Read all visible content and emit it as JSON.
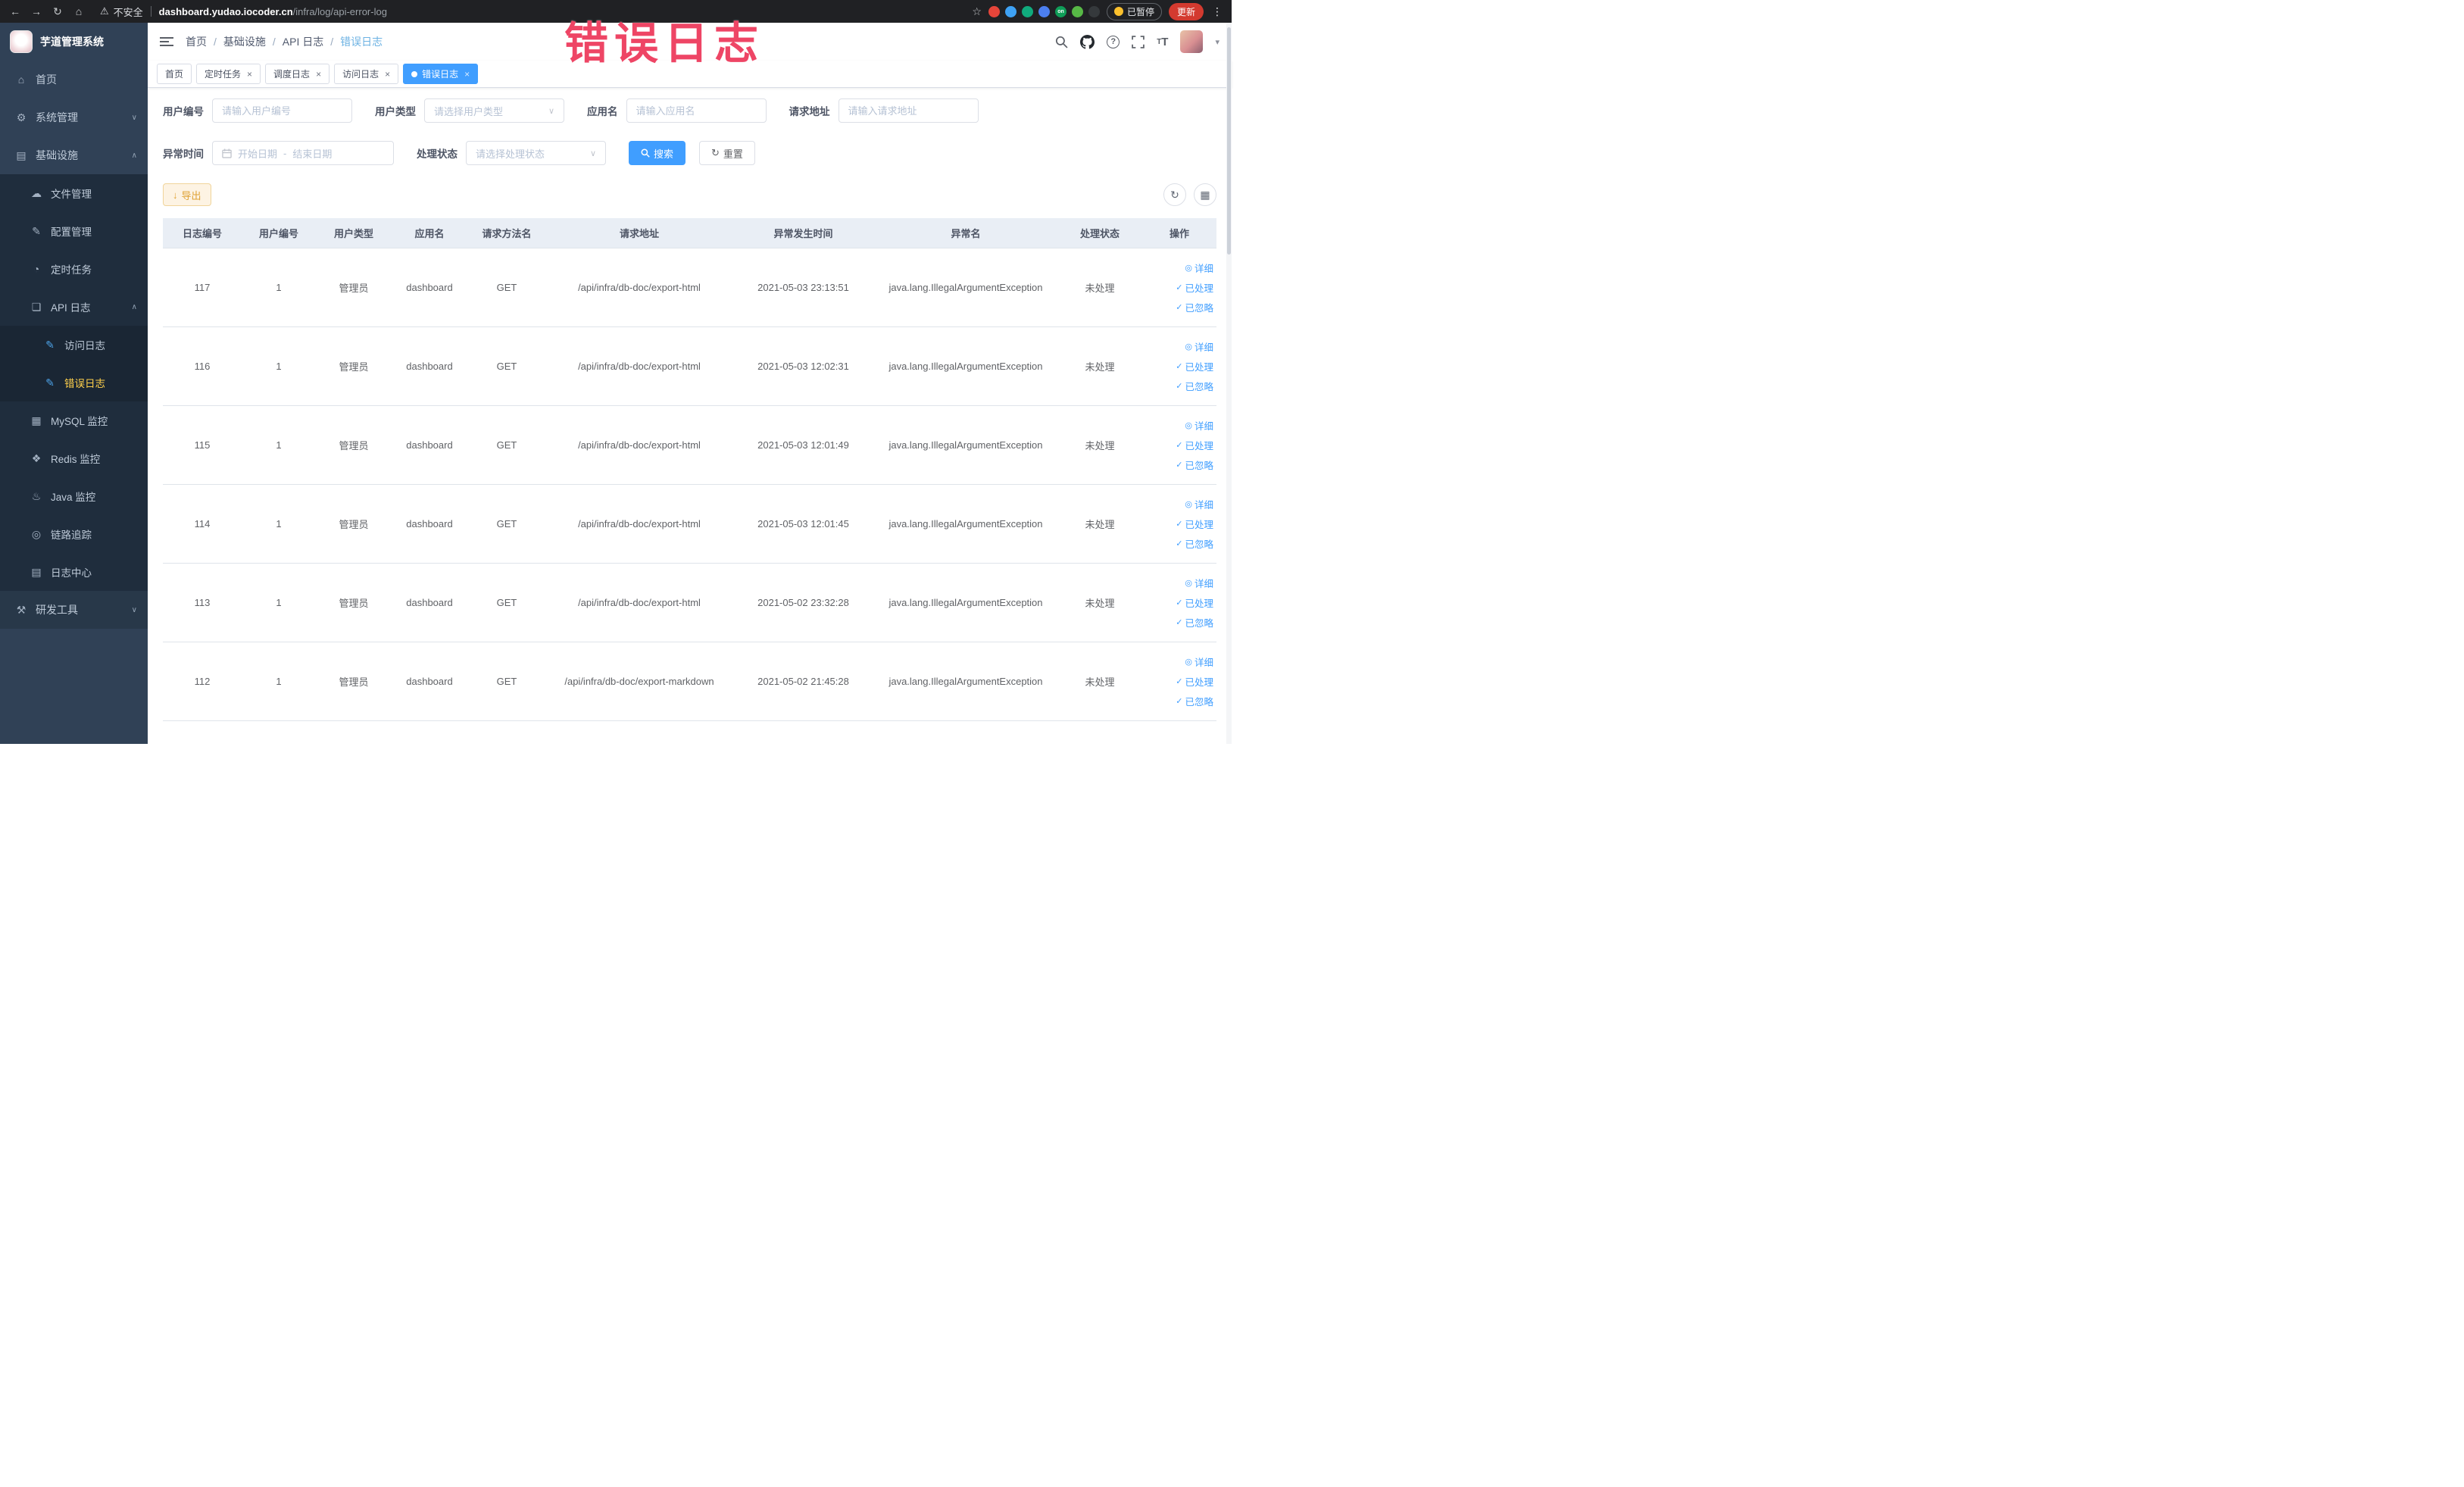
{
  "colors": {
    "accent": "#409eff",
    "menu_active": "#ffd04b",
    "warning": "#e6a23c"
  },
  "browser": {
    "security_label": "不安全",
    "url_domain": "dashboard.yudao.iocoder.cn",
    "url_path": "/infra/log/api-error-log",
    "paused_label": "已暂停",
    "update_label": "更新",
    "extensions": [
      {
        "name": "extension-red",
        "color": "#e5453a"
      },
      {
        "name": "extension-water",
        "color": "#3ea2f5"
      },
      {
        "name": "extension-teal",
        "color": "#10ab7d"
      },
      {
        "name": "extension-grid",
        "color": "#4c7ff0"
      },
      {
        "name": "extension-on",
        "color": "#0f9d58",
        "text": "on"
      },
      {
        "name": "extension-leaf",
        "color": "#57b846"
      },
      {
        "name": "extension-paw",
        "color": "#35393c"
      }
    ]
  },
  "annotation": {
    "text": "错误日志",
    "color": "#ee4565"
  },
  "sidebar": {
    "logo_title": "芋道管理系统",
    "items": [
      {
        "id": "home",
        "label": "首页",
        "icon": "home-icon",
        "glyph": "⌂",
        "level": 1
      },
      {
        "id": "system-management",
        "label": "系统管理",
        "icon": "gear-icon",
        "glyph": "⚙",
        "level": 1,
        "arrow": "down"
      },
      {
        "id": "infrastructure",
        "label": "基础设施",
        "icon": "monitor-icon",
        "glyph": "▤",
        "level": 1,
        "arrow": "up"
      },
      {
        "id": "file-management",
        "label": "文件管理",
        "icon": "cloud-icon",
        "glyph": "☁",
        "level": 2
      },
      {
        "id": "config-management",
        "label": "配置管理",
        "icon": "edit-icon",
        "glyph": "✎",
        "level": 2
      },
      {
        "id": "scheduled-tasks",
        "label": "定时任务",
        "icon": "timer-icon",
        "glyph": "◔",
        "level": 2
      },
      {
        "id": "api-logs",
        "label": "API 日志",
        "icon": "document-icon",
        "glyph": "❏",
        "level": 2,
        "arrow": "up"
      },
      {
        "id": "access-log",
        "label": "访问日志",
        "icon": "log-doc-icon",
        "glyph": "✎",
        "level": 3,
        "icon_color": "#4da3e8"
      },
      {
        "id": "error-log",
        "label": "错误日志",
        "icon": "log-doc-icon",
        "glyph": "✎",
        "level": 3,
        "icon_color": "#4da3e8",
        "active": true
      },
      {
        "id": "mysql-monitor",
        "label": "MySQL 监控",
        "icon": "database-icon",
        "glyph": "▦",
        "level": 2
      },
      {
        "id": "redis-monitor",
        "label": "Redis 监控",
        "icon": "redis-icon",
        "glyph": "❖",
        "level": 2
      },
      {
        "id": "java-monitor",
        "label": "Java 监控",
        "icon": "java-icon",
        "glyph": "♨",
        "level": 2
      },
      {
        "id": "tracing",
        "label": "链路追踪",
        "icon": "trace-icon",
        "glyph": "◎",
        "level": 2
      },
      {
        "id": "log-center",
        "label": "日志中心",
        "icon": "log-center-icon",
        "glyph": "▤",
        "level": 2
      },
      {
        "id": "dev-tools",
        "label": "研发工具",
        "icon": "tools-icon",
        "glyph": "⚒",
        "level": 1,
        "arrow": "down",
        "shaded": true
      }
    ]
  },
  "breadcrumb": [
    "首页",
    "基础设施",
    "API 日志",
    "错误日志"
  ],
  "tabs": [
    {
      "id": "home",
      "label": "首页",
      "closable": false,
      "active": false
    },
    {
      "id": "scheduled-tasks",
      "label": "定时任务",
      "closable": true,
      "active": false
    },
    {
      "id": "schedule-log",
      "label": "调度日志",
      "closable": true,
      "active": false
    },
    {
      "id": "access-log",
      "label": "访问日志",
      "closable": true,
      "active": false
    },
    {
      "id": "error-log",
      "label": "错误日志",
      "closable": true,
      "active": true
    }
  ],
  "filters": {
    "user_id": {
      "label": "用户编号",
      "placeholder": "请输入用户编号"
    },
    "user_type": {
      "label": "用户类型",
      "placeholder": "请选择用户类型"
    },
    "app_name": {
      "label": "应用名",
      "placeholder": "请输入应用名"
    },
    "request_url": {
      "label": "请求地址",
      "placeholder": "请输入请求地址"
    },
    "exception_time": {
      "label": "异常时间",
      "start_placeholder": "开始日期",
      "separator": "-",
      "end_placeholder": "结束日期"
    },
    "process_status": {
      "label": "处理状态",
      "placeholder": "请选择处理状态"
    },
    "search_label": "搜索",
    "reset_label": "重置"
  },
  "toolbar": {
    "export_label": "导出"
  },
  "table": {
    "columns": [
      "日志编号",
      "用户编号",
      "用户类型",
      "应用名",
      "请求方法名",
      "请求地址",
      "异常发生时间",
      "异常名",
      "处理状态",
      "操作"
    ],
    "row_actions": [
      {
        "id": "detail",
        "label": "详细",
        "icon": "view-icon",
        "glyph": "◎"
      },
      {
        "id": "processed",
        "label": "已处理",
        "icon": "check-icon",
        "glyph": "✓"
      },
      {
        "id": "ignored",
        "label": "已忽略",
        "icon": "check-icon",
        "glyph": "✓"
      }
    ],
    "rows": [
      {
        "log_id": "117",
        "user_id": "1",
        "user_type": "管理员",
        "app_name": "dashboard",
        "method": "GET",
        "url": "/api/infra/db-doc/export-html",
        "time": "2021-05-03 23:13:51",
        "exception": "java.lang.IllegalArgumentException",
        "status": "未处理"
      },
      {
        "log_id": "116",
        "user_id": "1",
        "user_type": "管理员",
        "app_name": "dashboard",
        "method": "GET",
        "url": "/api/infra/db-doc/export-html",
        "time": "2021-05-03 12:02:31",
        "exception": "java.lang.IllegalArgumentException",
        "status": "未处理"
      },
      {
        "log_id": "115",
        "user_id": "1",
        "user_type": "管理员",
        "app_name": "dashboard",
        "method": "GET",
        "url": "/api/infra/db-doc/export-html",
        "time": "2021-05-03 12:01:49",
        "exception": "java.lang.IllegalArgumentException",
        "status": "未处理"
      },
      {
        "log_id": "114",
        "user_id": "1",
        "user_type": "管理员",
        "app_name": "dashboard",
        "method": "GET",
        "url": "/api/infra/db-doc/export-html",
        "time": "2021-05-03 12:01:45",
        "exception": "java.lang.IllegalArgumentException",
        "status": "未处理"
      },
      {
        "log_id": "113",
        "user_id": "1",
        "user_type": "管理员",
        "app_name": "dashboard",
        "method": "GET",
        "url": "/api/infra/db-doc/export-html",
        "time": "2021-05-02 23:32:28",
        "exception": "java.lang.IllegalArgumentException",
        "status": "未处理"
      },
      {
        "log_id": "112",
        "user_id": "1",
        "user_type": "管理员",
        "app_name": "dashboard",
        "method": "GET",
        "url": "/api/infra/db-doc/export-markdown",
        "time": "2021-05-02 21:45:28",
        "exception": "java.lang.IllegalArgumentException",
        "status": "未处理"
      }
    ]
  }
}
